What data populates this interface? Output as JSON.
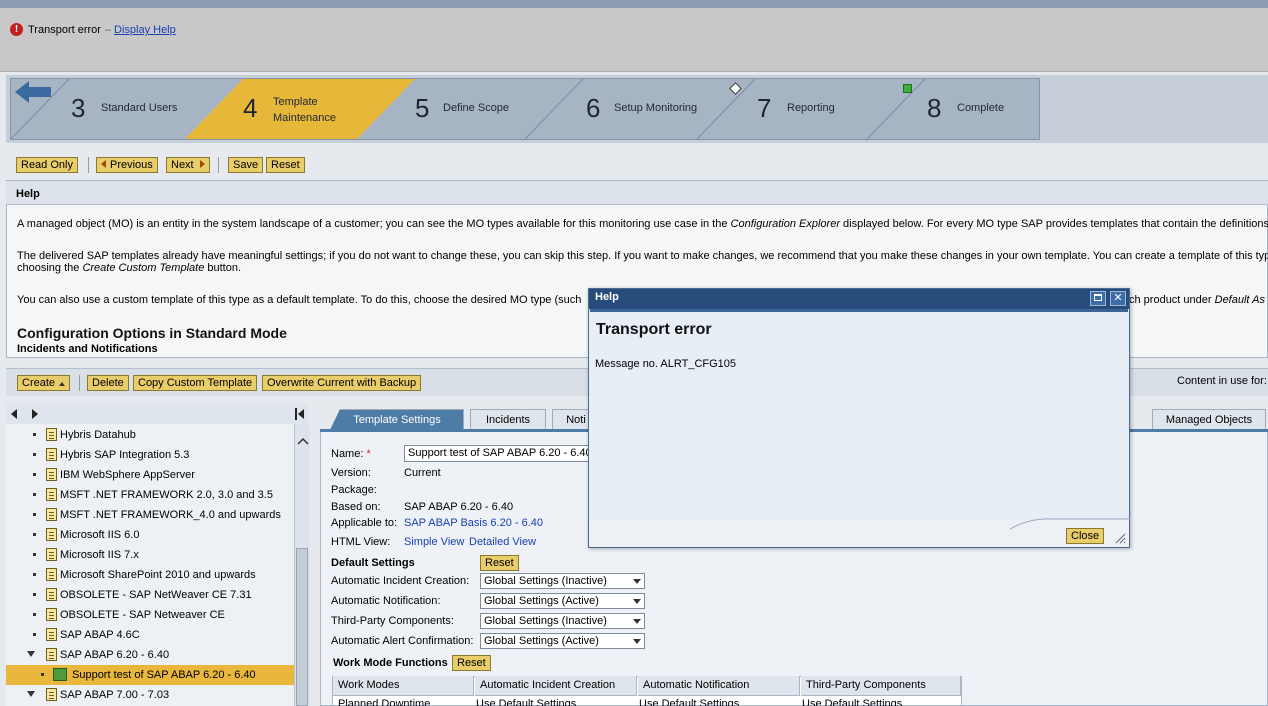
{
  "message": {
    "icon": "error-icon",
    "text": "Transport error",
    "separator": "–",
    "help_link": "Display Help"
  },
  "roadmap": {
    "steps": [
      {
        "num": "3",
        "label": "Standard Users"
      },
      {
        "num": "4",
        "label_line1": "Template",
        "label_line2": "Maintenance"
      },
      {
        "num": "5",
        "label": "Define Scope"
      },
      {
        "num": "6",
        "label": "Setup Monitoring"
      },
      {
        "num": "7",
        "label": "Reporting"
      },
      {
        "num": "8",
        "label": "Complete"
      }
    ]
  },
  "toolbar": {
    "read_only": "Read Only",
    "previous": "Previous",
    "next": "Next",
    "save": "Save",
    "reset": "Reset"
  },
  "help": {
    "title": "Help",
    "p1_a": "A managed object (MO) is an entity in the system landscape of a customer; you can see the MO types available for this monitoring use case in the ",
    "p1_em": "Configuration Explorer",
    "p1_b": " displayed below. For every MO type SAP provides templates that contain the definitions",
    "p2_a": "The delivered SAP templates already have meaningful settings; if you do not want to change these, you can skip this step. If you want to make changes, we recommend that you make these changes in your own template. You can create a template of this type",
    "p2_b1": "choosing the ",
    "p2_em": "Create Custom Template",
    "p2_b2": " button.",
    "p3_a": "You can also use a custom template of this type as a default template. To do this, choose the desired MO type (such",
    "p3_b": "ch product under ",
    "p3_em": "Default As",
    "cfg_heading": "Configuration Options in Standard Mode",
    "cfg_sub": "Incidents and Notifications"
  },
  "lower_toolbar": {
    "create": "Create",
    "delete": "Delete",
    "copy": "Copy Custom Template",
    "overwrite": "Overwrite Current with Backup",
    "content_use": "Content in use for:"
  },
  "tree": {
    "items": [
      {
        "label": "Hybris Datahub",
        "type": "leaf"
      },
      {
        "label": "Hybris SAP Integration 5.3",
        "type": "leaf"
      },
      {
        "label": "IBM WebSphere AppServer",
        "type": "leaf"
      },
      {
        "label": "MSFT .NET FRAMEWORK 2.0, 3.0 and 3.5",
        "type": "leaf"
      },
      {
        "label": "MSFT .NET FRAMEWORK_4.0 and upwards",
        "type": "leaf"
      },
      {
        "label": "Microsoft IIS 6.0",
        "type": "leaf"
      },
      {
        "label": "Microsoft IIS 7.x",
        "type": "leaf"
      },
      {
        "label": "Microsoft SharePoint 2010 and upwards",
        "type": "leaf"
      },
      {
        "label": "OBSOLETE - SAP NetWeaver CE 7.31",
        "type": "leaf"
      },
      {
        "label": "OBSOLETE - SAP Netweaver CE",
        "type": "leaf"
      },
      {
        "label": "SAP ABAP 4.6C",
        "type": "leaf"
      },
      {
        "label": "SAP ABAP 6.20 - 6.40",
        "type": "open"
      },
      {
        "label": "Support test of SAP ABAP 6.20 - 6.40",
        "type": "child-selected"
      },
      {
        "label": "SAP ABAP 7.00 - 7.03",
        "type": "open"
      }
    ]
  },
  "tabs": {
    "template_settings": "Template Settings",
    "incidents": "Incidents",
    "notifications": "Noti",
    "managed_objects": "Managed Objects"
  },
  "details": {
    "name_label": "Name:",
    "name_value": "Support test of SAP ABAP 6.20 - 6.40",
    "version_label": "Version:",
    "version_value": "Current",
    "package_label": "Package:",
    "based_label": "Based on:",
    "based_value": "SAP ABAP 6.20 - 6.40",
    "applicable_label": "Applicable to:",
    "applicable_value": "SAP ABAP Basis 6.20 - 6.40",
    "html_label": "HTML View:",
    "simple_view": "Simple View",
    "detailed_view": "Detailed View",
    "default_settings": "Default Settings",
    "reset": "Reset",
    "auto_incident_label": "Automatic Incident Creation:",
    "auto_incident_value": "Global Settings (Inactive)",
    "auto_notif_label": "Automatic Notification:",
    "auto_notif_value": "Global Settings (Active)",
    "third_party_label": "Third-Party Components:",
    "third_party_value": "Global Settings (Inactive)",
    "auto_alert_label": "Automatic Alert Confirmation:",
    "auto_alert_value": "Global Settings (Active)",
    "work_mode_functions": "Work Mode Functions"
  },
  "work_table": {
    "headers": [
      "Work Modes",
      "Automatic Incident Creation",
      "Automatic Notification",
      "Third-Party Components"
    ],
    "row": [
      "Planned Downtime",
      "Use Default Settings",
      "Use Default Settings",
      "Use Default Settings"
    ]
  },
  "dialog": {
    "title": "Help",
    "heading": "Transport error",
    "message": "Message no. ALRT_CFG105",
    "close": "Close"
  }
}
